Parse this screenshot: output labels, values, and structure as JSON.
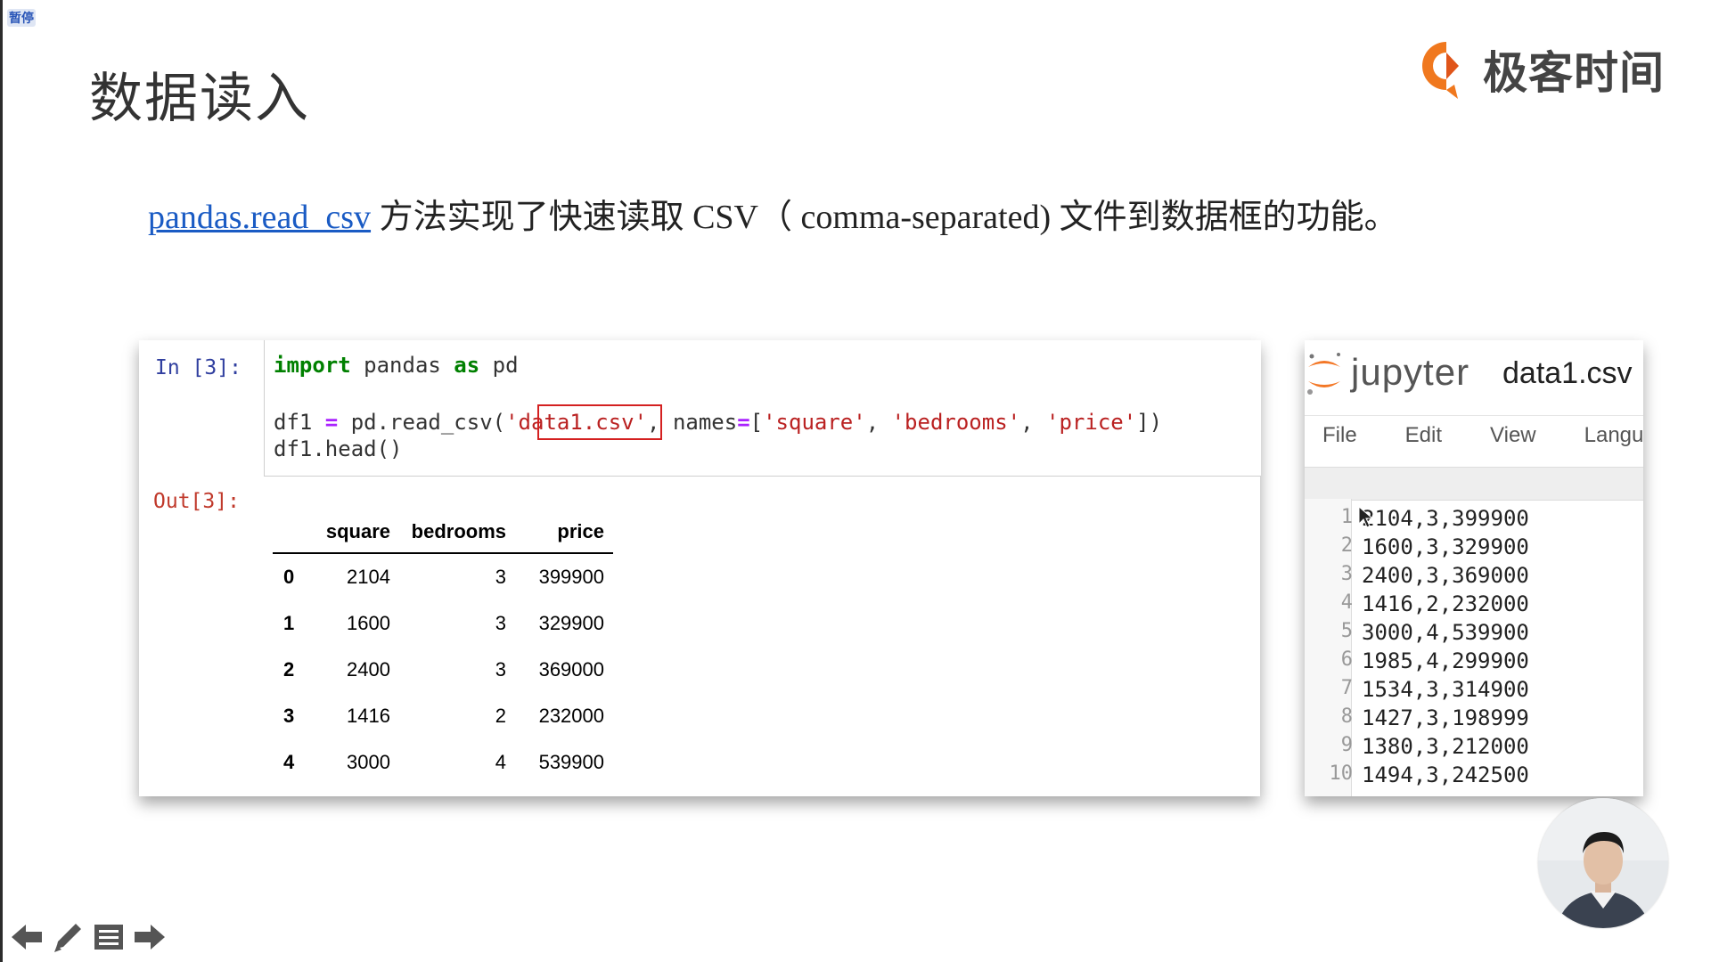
{
  "pause_badge": "暂停",
  "slide": {
    "title": "数据读入",
    "description_link": "pandas.read_csv",
    "description_rest": " 方法实现了快速读取 CSV（ comma-separated) 文件到数据框的功能。"
  },
  "brand": {
    "name": "极客时间",
    "color": "#f0781e"
  },
  "notebook": {
    "in_prompt": "In [3]:",
    "out_prompt": "Out[3]:",
    "code": {
      "line1_kw1": "import",
      "line1_mid": " pandas ",
      "line1_kw2": "as",
      "line1_end": " pd",
      "line2_var": "df1 ",
      "line2_eq": "=",
      "line2_obj": " pd.",
      "line2_func": "read_csv",
      "line2_open": "(",
      "line2_arg1": "'data1.csv'",
      "line2_mid": ", names",
      "line2_eq2": "=",
      "line2_brack": "[",
      "line2_s1": "'square'",
      "line2_c1": ", ",
      "line2_s2": "'bedrooms'",
      "line2_c2": ", ",
      "line2_s3": "'price'",
      "line2_close": "])",
      "line3": "df1.head()"
    },
    "table": {
      "columns": [
        "",
        "square",
        "bedrooms",
        "price"
      ],
      "rows": [
        [
          "0",
          "2104",
          "3",
          "399900"
        ],
        [
          "1",
          "1600",
          "3",
          "329900"
        ],
        [
          "2",
          "2400",
          "3",
          "369000"
        ],
        [
          "3",
          "1416",
          "2",
          "232000"
        ],
        [
          "4",
          "3000",
          "4",
          "539900"
        ]
      ]
    }
  },
  "jupyter": {
    "logo_text": "jupyter",
    "filename": "data1.csv",
    "menu": [
      "File",
      "Edit",
      "View",
      "Langu"
    ],
    "lines": [
      {
        "n": "1",
        "text": "2104,3,399900"
      },
      {
        "n": "2",
        "text": "1600,3,329900"
      },
      {
        "n": "3",
        "text": "2400,3,369000"
      },
      {
        "n": "4",
        "text": "1416,2,232000"
      },
      {
        "n": "5",
        "text": "3000,4,539900"
      },
      {
        "n": "6",
        "text": "1985,4,299900"
      },
      {
        "n": "7",
        "text": "1534,3,314900"
      },
      {
        "n": "8",
        "text": "1427,3,198999"
      },
      {
        "n": "9",
        "text": "1380,3,212000"
      },
      {
        "n": "10",
        "text": "1494,3,242500"
      }
    ]
  },
  "nav": [
    "arrow-left-icon",
    "pen-icon",
    "notes-icon",
    "arrow-right-icon"
  ]
}
